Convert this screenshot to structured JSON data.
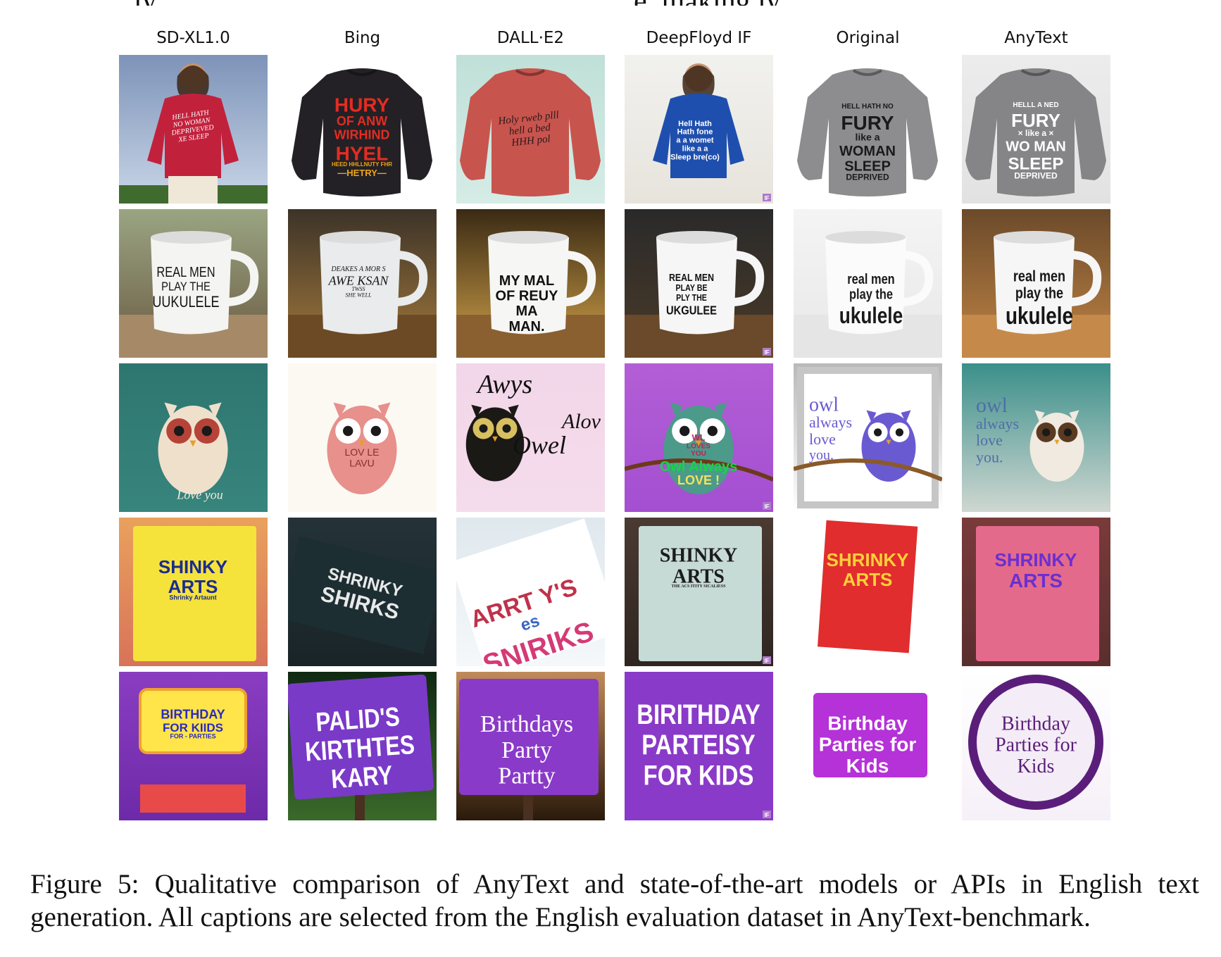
{
  "top_text": {
    "left": "ly",
    "right": "e, making ly"
  },
  "columns": [
    "SD-XL1.0",
    "Bing",
    "DALL·E2",
    "DeepFloyd IF",
    "Original",
    "AnyText"
  ],
  "rows": [
    {
      "subject": "sweatshirt",
      "cells": [
        {
          "lines": [
            "HELL HATH",
            "NO WOMAN",
            "DEPRIVEVED",
            "XE SLEEP"
          ]
        },
        {
          "lines": [
            "HURY",
            "OF ANW",
            "WIRHIND",
            "HYEL",
            "HEED HHLLNUTY FHR",
            "—HETRY—"
          ]
        },
        {
          "lines": [
            "Holy rweb plll",
            "hell a bed",
            "HHH pol"
          ]
        },
        {
          "lines": [
            "Hell Hath",
            "Hath fone",
            "a a womet",
            "like a a",
            "Sleep bre(co)"
          ],
          "badge": "IF"
        },
        {
          "lines": [
            "HELL HATH NO",
            "FURY",
            "like a",
            "WOMAN",
            "SLEEP",
            "DEPRIVED"
          ]
        },
        {
          "lines": [
            "HELLL A NED",
            "FURY",
            "× like a ×",
            "WO MAN",
            "SLEEP",
            "DEPRIVED"
          ]
        }
      ]
    },
    {
      "subject": "mug",
      "cells": [
        {
          "lines": [
            "REAL MEN",
            "PLAY THE",
            "UUKULELE"
          ]
        },
        {
          "lines": [
            "DEAKES A MOR S",
            "AWE KSAN",
            "TWSS",
            "SHE WELL"
          ]
        },
        {
          "lines": [
            "MY MAL",
            "OF REUY",
            "MA",
            "MAN."
          ]
        },
        {
          "lines": [
            "REAL MEN",
            "PLAY BE",
            "PLY THE",
            "UKGULEE"
          ],
          "badge": "IF"
        },
        {
          "lines": [
            "real men",
            "play the",
            "ukulele"
          ]
        },
        {
          "lines": [
            "real men",
            "play the",
            "ukulele"
          ]
        }
      ]
    },
    {
      "subject": "owl",
      "cells": [
        {
          "lines": [
            "Love you"
          ]
        },
        {
          "lines": [
            "LOV LE",
            "LAVU"
          ]
        },
        {
          "lines": [
            "Awys",
            "Alov",
            "Owel"
          ]
        },
        {
          "lines": [
            "WL",
            "LOVES",
            "YOU",
            "Owl Always",
            "LOVE !"
          ],
          "badge": "IF"
        },
        {
          "lines": [
            "owl",
            "always",
            "love",
            "you."
          ]
        },
        {
          "lines": [
            "owl",
            "always",
            "love",
            "you."
          ]
        }
      ]
    },
    {
      "subject": "book",
      "cells": [
        {
          "lines": [
            "SHINKY",
            "ARTS",
            "Shrinky Artaunt"
          ]
        },
        {
          "lines": [
            "SHRINKY",
            "SHIRKS"
          ]
        },
        {
          "lines": [
            "ARRT Y'S",
            "es",
            "SNIRIKS"
          ]
        },
        {
          "lines": [
            "SHINKY",
            "ARTS",
            "THE ACS ITITY SICALIESS"
          ],
          "badge": "IF"
        },
        {
          "lines": [
            "SHRINKY",
            "ARTS"
          ]
        },
        {
          "lines": [
            "SHRINKY",
            "ARTS"
          ]
        }
      ]
    },
    {
      "subject": "sign",
      "cells": [
        {
          "lines": [
            "BIRTHDAY",
            "FOR KIIDS",
            "FOR - PARTIES"
          ]
        },
        {
          "lines": [
            "PALID'S",
            "KIRTHTES",
            "KARY"
          ]
        },
        {
          "lines": [
            "Birthdays",
            "Party",
            "Partty"
          ]
        },
        {
          "lines": [
            "BIRITHDAY",
            "PARTEISY",
            "FOR KIDS"
          ],
          "badge": "IF"
        },
        {
          "lines": [
            "Birthday",
            "Parties for",
            "Kids"
          ]
        },
        {
          "lines": [
            "Birthday",
            "Parties for",
            "Kids"
          ]
        }
      ]
    }
  ],
  "caption": "Figure 5: Qualitative comparison of AnyText and state-of-the-art models or APIs in English text generation. All captions are selected from the English evaluation dataset in AnyText-benchmark."
}
